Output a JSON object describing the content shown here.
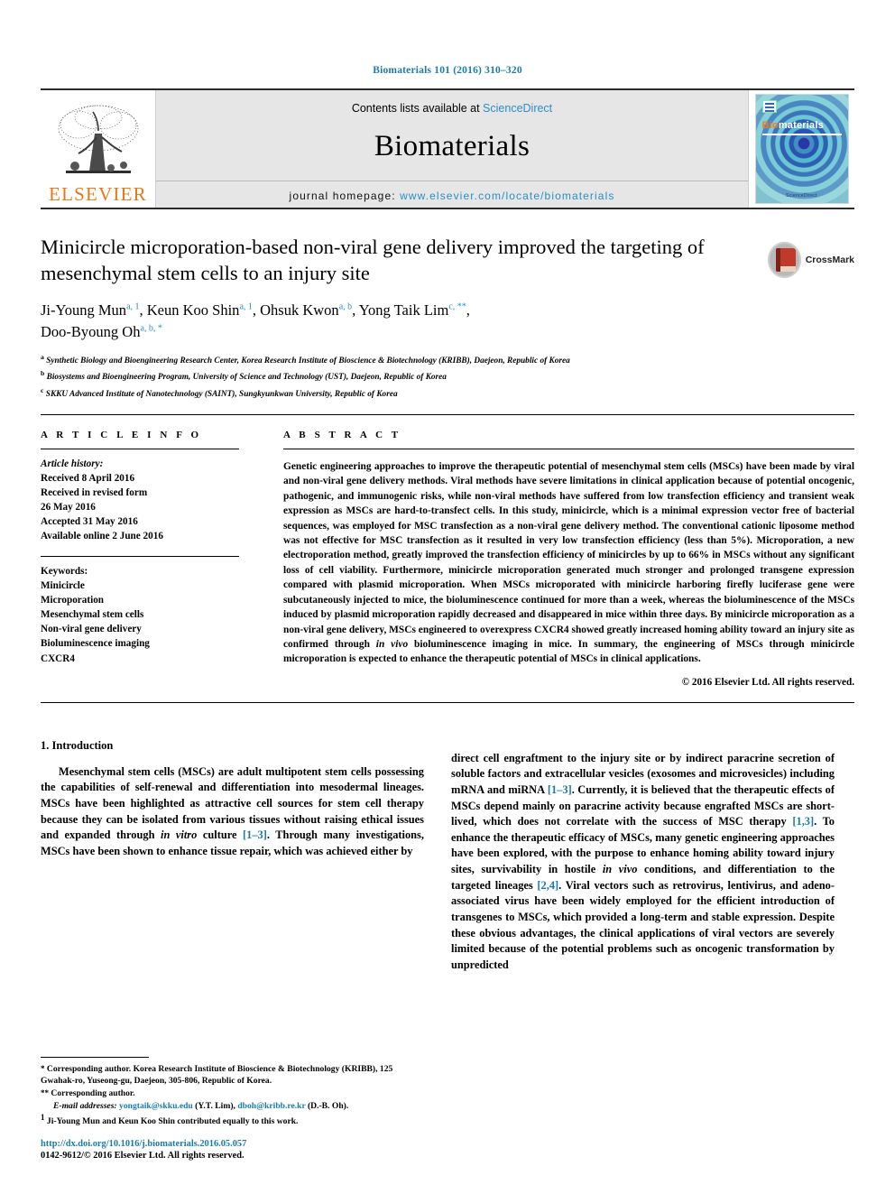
{
  "running_head": "Biomaterials 101 (2016) 310–320",
  "banner": {
    "publisher_logo_label": "ELSEVIER",
    "contents_prefix": "Contents lists available at ",
    "contents_link": "ScienceDirect",
    "journal_name": "Biomaterials",
    "homepage_prefix": "journal homepage: ",
    "homepage_url": "www.elsevier.com/locate/biomaterials",
    "cover": {
      "title_first": "Bio",
      "title_rest": "materials",
      "footer": "ScienceDirect"
    }
  },
  "article": {
    "title": "Minicircle microporation-based non-viral gene delivery improved the targeting of mesenchymal stem cells to an injury site",
    "crossmark_label": "CrossMark",
    "authors_line1": [
      {
        "name": "Ji-Young Mun",
        "sup": "a, 1",
        "sep": ", "
      },
      {
        "name": "Keun Koo Shin",
        "sup": "a, 1",
        "sep": ", "
      },
      {
        "name": "Ohsuk Kwon",
        "sup": "a, b",
        "sep": ", "
      },
      {
        "name": "Yong Taik Lim",
        "sup": "c, **",
        "sep": ","
      }
    ],
    "authors_line2": [
      {
        "name": "Doo-Byoung Oh",
        "sup": "a, b, *",
        "sep": ""
      }
    ],
    "affiliations": [
      {
        "mark": "a",
        "text": "Synthetic Biology and Bioengineering Research Center, Korea Research Institute of Bioscience & Biotechnology (KRIBB), Daejeon, Republic of Korea"
      },
      {
        "mark": "b",
        "text": "Biosystems and Bioengineering Program, University of Science and Technology (UST), Daejeon, Republic of Korea"
      },
      {
        "mark": "c",
        "text": "SKKU Advanced Institute of Nanotechnology (SAINT), Sungkyunkwan University, Republic of Korea"
      }
    ]
  },
  "article_info": {
    "heading": "A R T I C L E   I N F O",
    "history_label": "Article history:",
    "history": [
      "Received 8 April 2016",
      "Received in revised form",
      "26 May 2016",
      "Accepted 31 May 2016",
      "Available online 2 June 2016"
    ],
    "keywords_label": "Keywords:",
    "keywords": [
      "Minicircle",
      "Microporation",
      "Mesenchymal stem cells",
      "Non-viral gene delivery",
      "Bioluminescence imaging",
      "CXCR4"
    ]
  },
  "abstract": {
    "heading": "A B S T R A C T",
    "text": "Genetic engineering approaches to improve the therapeutic potential of mesenchymal stem cells (MSCs) have been made by viral and non-viral gene delivery methods. Viral methods have severe limitations in clinical application because of potential oncogenic, pathogenic, and immunogenic risks, while non-viral methods have suffered from low transfection efficiency and transient weak expression as MSCs are hard-to-transfect cells. In this study, minicircle, which is a minimal expression vector free of bacterial sequences, was employed for MSC transfection as a non-viral gene delivery method. The conventional cationic liposome method was not effective for MSC transfection as it resulted in very low transfection efficiency (less than 5%). Microporation, a new electroporation method, greatly improved the transfection efficiency of minicircles by up to 66% in MSCs without any significant loss of cell viability. Furthermore, minicircle microporation generated much stronger and prolonged transgene expression compared with plasmid microporation. When MSCs microporated with minicircle harboring firefly luciferase gene were subcutaneously injected to mice, the bioluminescence continued for more than a week, whereas the bioluminescence of the MSCs induced by plasmid microporation rapidly decreased and disappeared in mice within three days. By minicircle microporation as a non-viral gene delivery, MSCs engineered to overexpress CXCR4 showed greatly increased homing ability toward an injury site as confirmed through in vivo bioluminescence imaging in mice. In summary, the engineering of MSCs through minicircle microporation is expected to enhance the therapeutic potential of MSCs in clinical applications.",
    "abstract_italic_phrase": "in vivo",
    "copyright": "© 2016 Elsevier Ltd. All rights reserved."
  },
  "introduction": {
    "heading": "1.  Introduction",
    "left_paragraph_parts": [
      "Mesenchymal stem cells (MSCs) are adult multipotent stem cells possessing the capabilities of self-renewal and differentiation into mesodermal lineages. MSCs have been highlighted as attractive cell sources for stem cell therapy because they can be isolated from various tissues without raising ethical issues and expanded through ",
      "in vitro",
      " culture ",
      "[1–3]",
      ". Through many investigations, MSCs have been shown to enhance tissue repair, which was achieved either by"
    ],
    "right_paragraph_parts": [
      "direct cell engraftment to the injury site or by indirect paracrine secretion of soluble factors and extracellular vesicles (exosomes and microvesicles) including mRNA and miRNA ",
      "[1–3]",
      ". Currently, it is believed that the therapeutic effects of MSCs depend mainly on paracrine activity because engrafted MSCs are short-lived, which does not correlate with the success of MSC therapy ",
      "[1,3]",
      ". To enhance the therapeutic efficacy of MSCs, many genetic engineering approaches have been explored, with the purpose to enhance homing ability toward injury sites, survivability in hostile ",
      "in vivo",
      " conditions, and differentiation to the targeted lineages ",
      "[2,4]",
      ". Viral vectors such as retrovirus, lentivirus, and adeno-associated virus have been widely employed for the efficient introduction of transgenes to MSCs, which provided a long-term and stable expression. Despite these obvious advantages, the clinical applications of viral vectors are severely limited because of the potential problems such as oncogenic transformation by unpredicted"
    ]
  },
  "footnotes": {
    "corresponding_1_mark": "*",
    "corresponding_1": "Corresponding author. Korea Research Institute of Bioscience & Biotechnology (KRIBB), 125 Gwahak-ro, Yuseong-gu, Daejeon, 305-806, Republic of Korea.",
    "corresponding_2_mark": "**",
    "corresponding_2": "Corresponding author.",
    "email_label": "E-mail addresses:",
    "email_1": "yongtaik@skku.edu",
    "email_1_owner": " (Y.T. Lim), ",
    "email_2": "dboh@kribb.re.kr",
    "email_2_owner": " (D.-B. Oh).",
    "equal_mark": "1",
    "equal_contrib": "Ji-Young Mun and Keun Koo Shin contributed equally to this work.",
    "doi": "http://dx.doi.org/10.1016/j.biomaterials.2016.05.057",
    "issn": "0142-9612/© 2016 Elsevier Ltd. All rights reserved."
  },
  "colors": {
    "link_blue": "#1a7aab",
    "science_direct_blue": "#2a8fc4",
    "elsevier_orange": "#e77817",
    "crossmark_red": "#c0392b"
  }
}
